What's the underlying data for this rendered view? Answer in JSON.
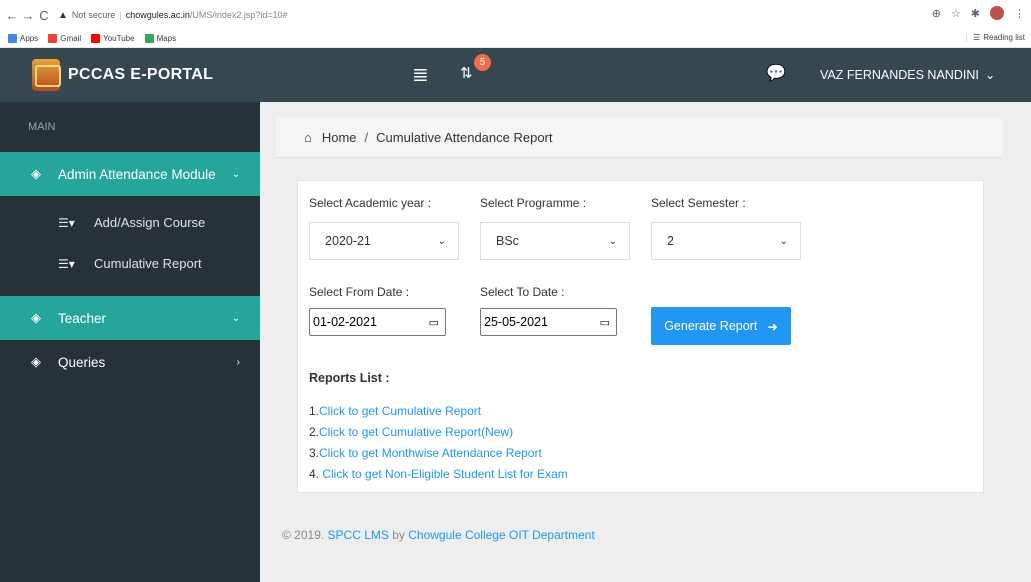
{
  "browser": {
    "url_warning": "Not secure",
    "url_host": "chowgules.ac.in",
    "url_path": "/UMS/index2.jsp?id=10#",
    "bookmarks": [
      "Apps",
      "Gmail",
      "YouTube",
      "Maps"
    ],
    "reading_list": "Reading list"
  },
  "header": {
    "brand": "PCCAS E-PORTAL",
    "notification_count": "5",
    "user_name": "VAZ FERNANDES NANDINI"
  },
  "sidebar": {
    "section_label": "MAIN",
    "items": [
      {
        "label": "Admin Attendance Module",
        "active": true
      },
      {
        "label": "Teacher",
        "active": true
      },
      {
        "label": "Queries",
        "active": false
      }
    ],
    "sub_items": [
      "Add/Assign Course",
      "Cumulative Report"
    ]
  },
  "breadcrumb": {
    "home": "Home",
    "current": "Cumulative Attendance Report"
  },
  "form": {
    "academic_year_label": "Select Academic year :",
    "academic_year_value": "2020-21",
    "programme_label": "Select Programme :",
    "programme_value": "BSc",
    "semester_label": "Select Semester :",
    "semester_value": "2",
    "from_date_label": "Select From Date :",
    "from_date_value": "01-02-2021",
    "to_date_label": "Select To Date :",
    "to_date_value": "25-05-2021",
    "generate_label": "Generate Report"
  },
  "reports": {
    "title": "Reports List :",
    "items": [
      {
        "num": "1.",
        "label": "Click to get Cumulative Report"
      },
      {
        "num": "2.",
        "label": "Click to get Cumulative Report(New)"
      },
      {
        "num": "3.",
        "label": "Click to get Monthwise Attendance Report"
      },
      {
        "num": "4. ",
        "label": "Click to get Non-Eligible Student List for Exam"
      }
    ]
  },
  "footer": {
    "prefix": "© 2019. ",
    "product": "SPCC LMS",
    "by": " by ",
    "org": "Chowgule College OIT Department"
  },
  "colors": {
    "topbar": "#37474f",
    "sidebar": "#263238",
    "accent_teal": "#26a69a",
    "primary_blue": "#2196f3"
  }
}
